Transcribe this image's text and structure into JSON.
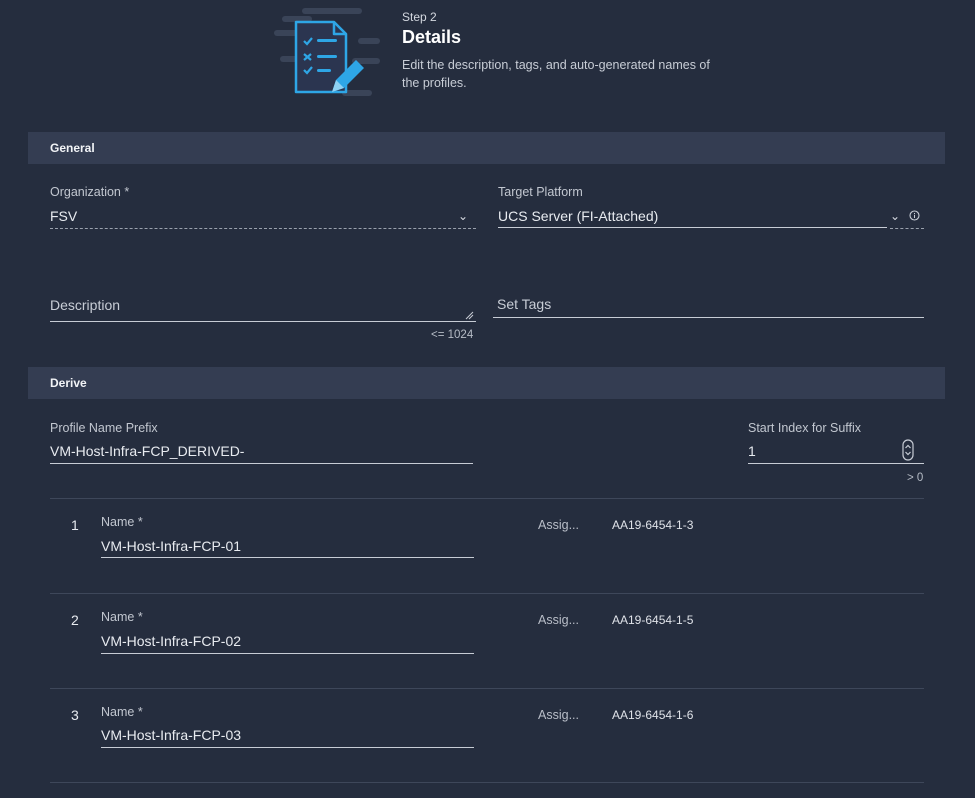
{
  "header": {
    "step": "Step 2",
    "title": "Details",
    "description": "Edit the description, tags, and auto-generated names of the profiles."
  },
  "general": {
    "section_title": "General",
    "organization": {
      "label": "Organization *",
      "value": "FSV"
    },
    "target_platform": {
      "label": "Target Platform",
      "value": "UCS Server (FI-Attached)"
    },
    "description": {
      "placeholder": "Description",
      "limit_hint": "<= 1024"
    },
    "tags": {
      "placeholder": "Set Tags"
    }
  },
  "derive": {
    "section_title": "Derive",
    "prefix": {
      "label": "Profile Name Prefix",
      "value": "VM-Host-Infra-FCP_DERIVED-"
    },
    "start_index": {
      "label": "Start Index for Suffix",
      "value": "1",
      "hint": "> 0"
    },
    "rows": [
      {
        "num": "1",
        "name_label": "Name *",
        "name": "VM-Host-Infra-FCP-01",
        "assign_label": "Assig...",
        "assigned": "AA19-6454-1-3"
      },
      {
        "num": "2",
        "name_label": "Name *",
        "name": "VM-Host-Infra-FCP-02",
        "assign_label": "Assig...",
        "assigned": "AA19-6454-1-5"
      },
      {
        "num": "3",
        "name_label": "Name *",
        "name": "VM-Host-Infra-FCP-03",
        "assign_label": "Assig...",
        "assigned": "AA19-6454-1-6"
      }
    ]
  },
  "icons": [
    "document-checklist-icon",
    "pencil-icon",
    "chevron-down-icon",
    "info-icon",
    "resize-handle-icon",
    "stepper-icon"
  ],
  "colors": {
    "background": "#252d3e",
    "section_bar": "#343d52",
    "accent": "#2ea6e6"
  }
}
